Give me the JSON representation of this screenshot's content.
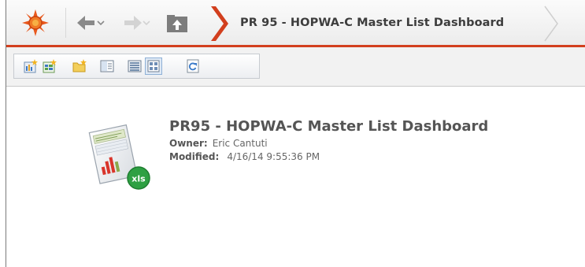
{
  "breadcrumb": {
    "title": "PR 95 - HOPWA-C Master List Dashboard"
  },
  "toolbar": {
    "buttons": [
      {
        "name": "new-dashboard-button",
        "icon": "new-dashboard-icon"
      },
      {
        "name": "new-report-button",
        "icon": "new-report-icon"
      },
      {
        "name": "new-folder-button",
        "icon": "folder-icon"
      },
      {
        "name": "details-pane-button",
        "icon": "details-pane-icon"
      },
      {
        "name": "list-view-button",
        "icon": "list-view-icon"
      },
      {
        "name": "icon-view-button",
        "icon": "icon-view-icon",
        "selected": true
      },
      {
        "name": "refresh-button",
        "icon": "refresh-icon"
      }
    ]
  },
  "item": {
    "title": "PR95 - HOPWA-C Master List Dashboard",
    "owner_label": "Owner:",
    "owner": "Eric Cantuti",
    "modified_label": "Modified:",
    "modified": "4/16/14 9:55:36 PM",
    "badge": "xls"
  },
  "colors": {
    "accent": "#d23f1e",
    "badge_green": "#2ea043"
  }
}
